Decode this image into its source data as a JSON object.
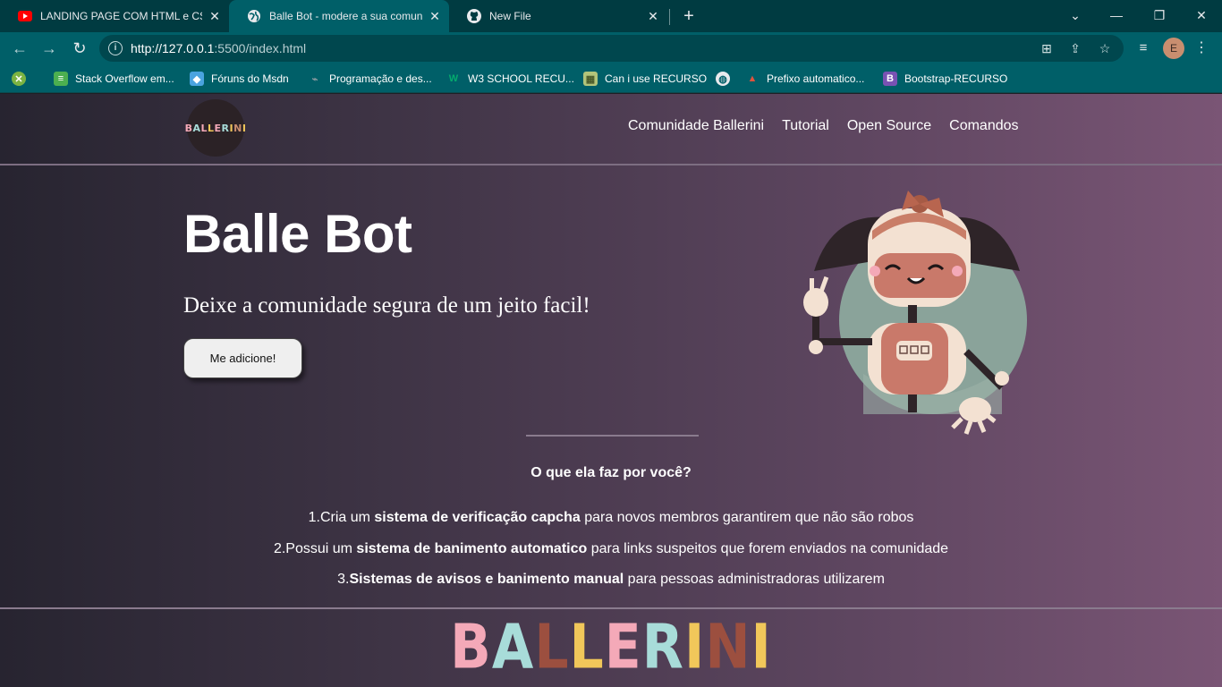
{
  "browser": {
    "tabs": [
      {
        "title": "LANDING PAGE COM HTML e CSS",
        "favicon": "youtube-icon"
      },
      {
        "title": "Balle Bot - modere a sua comunidade",
        "favicon": "globe-icon"
      },
      {
        "title": "New File",
        "favicon": "github-icon"
      }
    ],
    "url_host": "http://127.0.0.1",
    "url_rest": ":5500/index.html",
    "profile_initial": "E",
    "bookmarks": [
      {
        "label": "Stack Overflow em...",
        "icon": "stackoverflow-icon",
        "color": "#4caf50"
      },
      {
        "label": "Fóruns do Msdn",
        "icon": "msdn-icon",
        "color": "#4aa3df"
      },
      {
        "label": "Programação e des...",
        "icon": "devmedia-icon",
        "color": "#8a9aa0"
      },
      {
        "label": "W3 SCHOOL RECU...",
        "icon": "w3schools-icon",
        "color": "#04aa6d"
      },
      {
        "label": "Can i use RECURSO",
        "icon": "caniuse-icon",
        "color": "#b2c47a"
      },
      {
        "label": "Prefixo automatico...",
        "icon": "autoprefixer-icon",
        "color": "#e0533d"
      },
      {
        "label": "Bootstrap-RECURSO",
        "icon": "bootstrap-icon",
        "color": "#7952b3"
      }
    ]
  },
  "site": {
    "logo_text": "BALLERINI",
    "nav": [
      "Comunidade Ballerini",
      "Tutorial",
      "Open Source",
      "Comandos"
    ],
    "hero": {
      "title": "Balle Bot",
      "subtitle": "Deixe a comunidade segura de um jeito facil!",
      "cta_label": "Me adicione!"
    },
    "features_title": "O que ela faz por você?",
    "features": [
      {
        "prefix": "1.Cria um ",
        "bold": "sistema de verificação capcha",
        "suffix": " para novos membros garantirem que não são robos"
      },
      {
        "prefix": "2.Possui um ",
        "bold": "sistema de banimento automatico",
        "suffix": " para links suspeitos que forem enviados na comunidade"
      },
      {
        "prefix": "3.",
        "bold": "Sistemas de avisos e banimento manual",
        "suffix": " para pessoas administradoras utilizarem"
      }
    ],
    "footer_wordmark": {
      "letters": [
        "B",
        "A",
        "L",
        "L",
        "E",
        "R",
        "I",
        "N",
        "I"
      ],
      "colors": [
        "#f4a9b8",
        "#a8dcd9",
        "#9c4f3f",
        "#f1c75a",
        "#f4a9b8",
        "#a8dcd9",
        "#f1c75a",
        "#9c4f3f",
        "#f1c75a"
      ]
    }
  }
}
